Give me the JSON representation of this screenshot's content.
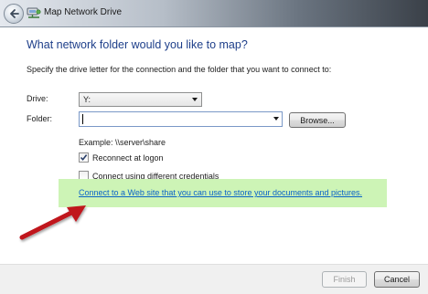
{
  "window": {
    "title": "Map Network Drive",
    "back_icon": "back-arrow-icon",
    "app_icon": "network-drive-icon"
  },
  "heading": "What network folder would you like to map?",
  "instruction": "Specify the drive letter for the connection and the folder that you want to connect to:",
  "drive": {
    "label": "Drive:",
    "value": "Y:"
  },
  "folder": {
    "label": "Folder:",
    "value": "",
    "browse_label": "Browse..."
  },
  "example": "Example: \\\\server\\share",
  "options": [
    {
      "label": "Reconnect at logon",
      "checked": true
    },
    {
      "label": "Connect using different credentials",
      "checked": false
    }
  ],
  "web_link": "Connect to a Web site that you can use to store your documents and pictures",
  "web_link_suffix": ".",
  "buttons": {
    "finish": "Finish",
    "cancel": "Cancel"
  },
  "colors": {
    "heading": "#1e3f8a",
    "link": "#0b64c8",
    "highlight": "#cdf4b6",
    "annotation_arrow": "#c0121b"
  }
}
